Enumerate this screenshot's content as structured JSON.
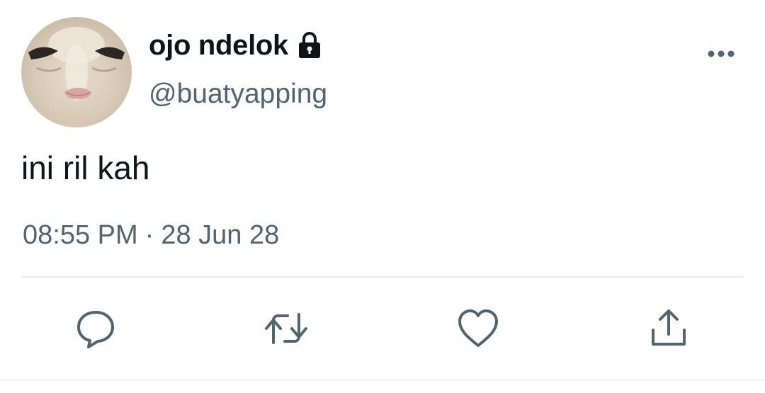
{
  "user": {
    "display_name": "ojo ndelok",
    "handle": "@buatyapping",
    "avatar_icon": "avatar-image",
    "protected_icon": "lock-icon"
  },
  "tweet": {
    "text": "ini ril kah",
    "time": "08:55 PM",
    "separator": "·",
    "date": "28 Jun 28"
  },
  "actions": [
    {
      "name": "reply",
      "icon": "comment-icon"
    },
    {
      "name": "retweet",
      "icon": "retweet-icon"
    },
    {
      "name": "like",
      "icon": "heart-icon"
    },
    {
      "name": "share",
      "icon": "share-icon"
    }
  ],
  "colors": {
    "text_primary": "#0f1419",
    "text_secondary": "#536471",
    "icon": "#536471",
    "divider": "#e6ecf0"
  }
}
